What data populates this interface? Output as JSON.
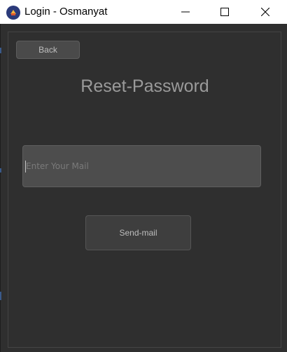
{
  "window": {
    "title": "Login - Osmanyat",
    "icon": "app-icon",
    "controls": [
      "minimize-icon",
      "maximize-icon",
      "close-icon"
    ]
  },
  "page": {
    "back_label": "Back",
    "heading": "Reset-Password",
    "mail_placeholder": "Enter Your Mail",
    "mail_value": "",
    "send_label": "Send-mail"
  },
  "colors": {
    "background": "#2f2f2f",
    "input_bg": "#4d4d4d",
    "button_bg": "#3e3e3e",
    "heading": "#9a9a9a"
  }
}
